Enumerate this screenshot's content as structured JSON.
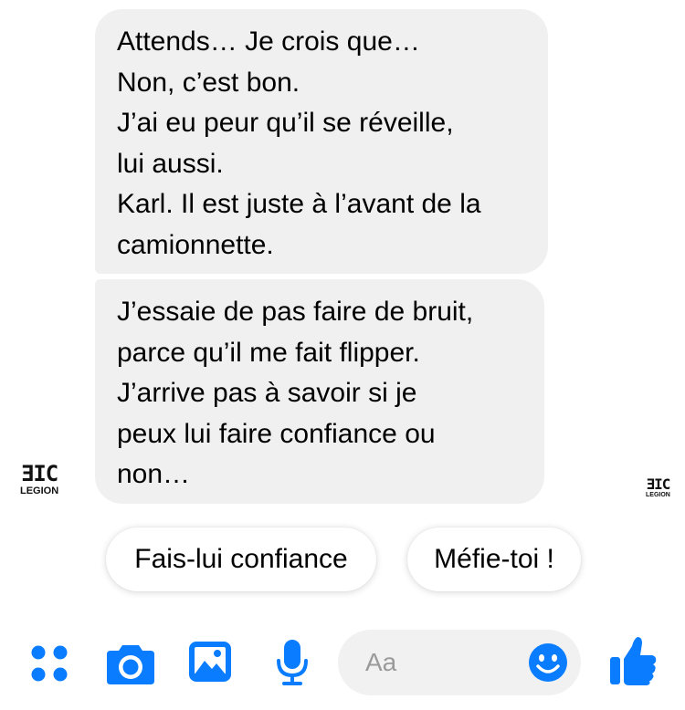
{
  "messages": [
    {
      "lines": [
        "Attends… Je crois que…",
        "Non, c’est bon.",
        "J’ai eu peur qu’il se réveille,",
        "lui aussi.",
        "Karl. Il est juste à l’avant de la",
        "camionnette."
      ]
    },
    {
      "lines": [
        "J’essaie de pas faire de bruit,",
        "parce qu’il me fait flipper.",
        "J’arrive pas à savoir si je",
        "peux lui faire confiance ou",
        "non…"
      ]
    }
  ],
  "avatar": {
    "glyph": "ƎIC",
    "word": "LEGION"
  },
  "read_receipt": {
    "glyph": "ƎIC",
    "word": "LEGION"
  },
  "quick_replies": [
    "Fais-lui confiance",
    "Méfie-toi !"
  ],
  "composer": {
    "placeholder": "Aa"
  },
  "toolbar": {
    "icons": [
      "apps-icon",
      "camera-icon",
      "image-icon",
      "microphone-icon",
      "emoji-icon",
      "thumbs-up-icon"
    ],
    "accent_color": "#0a7cff"
  },
  "colors": {
    "bubble": "#f0f0f0",
    "composer": "#f1f1f1",
    "placeholder": "#9a9a9a"
  }
}
